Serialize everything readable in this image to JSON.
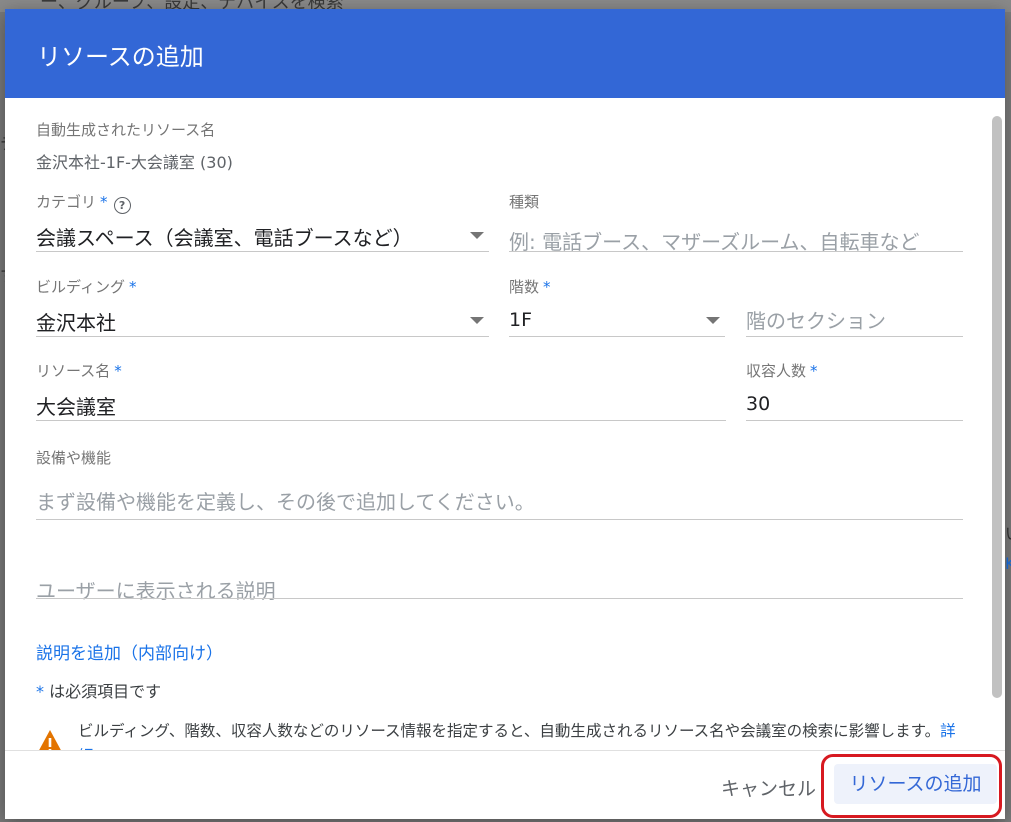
{
  "background": {
    "search_text": "ー、グループ、設定、デバイスを検索",
    "frag1": "テ",
    "frag2": "す",
    "frag3": "い",
    "frag4": "K"
  },
  "dialog": {
    "title": "リソースの追加",
    "generated_name_label": "自動生成されたリソース名",
    "generated_name_value": "金沢本社-1F-大会議室 (30)",
    "category": {
      "label": "カテゴリ",
      "required": "*",
      "value": "会議スペース（会議室、電話ブースなど）",
      "help_icon": "?"
    },
    "type": {
      "label": "種類",
      "placeholder": "例: 電話ブース、マザーズルーム、自転車など"
    },
    "building": {
      "label": "ビルディング",
      "required": "*",
      "value": "金沢本社"
    },
    "floor": {
      "label": "階数",
      "required": "*",
      "value": "1F"
    },
    "floor_section": {
      "placeholder": "階のセクション"
    },
    "resource_name": {
      "label": "リソース名",
      "required": "*",
      "value": "大会議室"
    },
    "capacity": {
      "label": "収容人数",
      "required": "*",
      "value": "30"
    },
    "features": {
      "label": "設備や機能",
      "placeholder": "まず設備や機能を定義し、その後で追加してください。"
    },
    "user_description": {
      "placeholder": "ユーザーに表示される説明"
    },
    "add_internal_description": "説明を追加（内部向け）",
    "required_note_star": "*",
    "required_note_text": " は必須項目です",
    "warning_text": "ビルディング、階数、収容人数などのリソース情報を指定すると、自動生成されるリソース名や会議室の検索に影響します。",
    "warning_link": "詳細",
    "cancel_button": "キャンセル",
    "add_button": "リソースの追加"
  },
  "colors": {
    "header": "#3367d6",
    "link": "#1a73e8",
    "warning": "#e37400",
    "highlight": "#d71920"
  }
}
